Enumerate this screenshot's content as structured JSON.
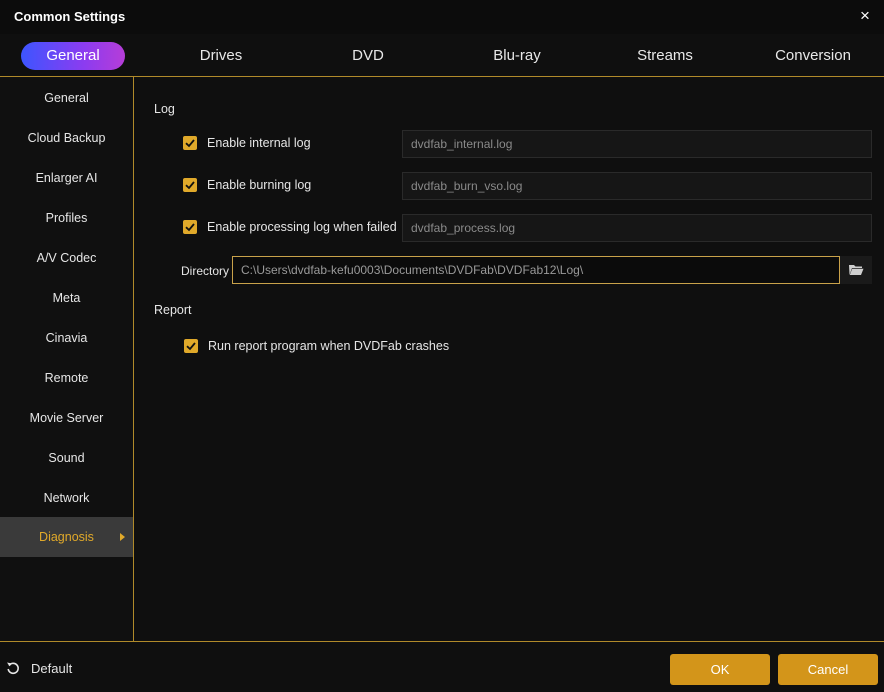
{
  "window": {
    "title": "Common Settings",
    "close_icon": "×"
  },
  "tabs": [
    {
      "label": "General",
      "active": true
    },
    {
      "label": "Drives"
    },
    {
      "label": "DVD"
    },
    {
      "label": "Blu-ray"
    },
    {
      "label": "Streams"
    },
    {
      "label": "Conversion"
    }
  ],
  "sidebar": {
    "items": [
      {
        "label": "General"
      },
      {
        "label": "Cloud Backup"
      },
      {
        "label": "Enlarger AI"
      },
      {
        "label": "Profiles"
      },
      {
        "label": "A/V Codec"
      },
      {
        "label": "Meta"
      },
      {
        "label": "Cinavia"
      },
      {
        "label": "Remote"
      },
      {
        "label": "Movie Server"
      },
      {
        "label": "Sound"
      },
      {
        "label": "Network"
      },
      {
        "label": "Diagnosis",
        "active": true
      }
    ]
  },
  "log": {
    "title": "Log",
    "internal": {
      "label": "Enable internal log",
      "checked": true,
      "value": "dvdfab_internal.log"
    },
    "burning": {
      "label": "Enable burning log",
      "checked": true,
      "value": "dvdfab_burn_vso.log"
    },
    "processing": {
      "label": "Enable processing log when failed",
      "checked": true,
      "value": "dvdfab_process.log"
    },
    "directory": {
      "label": "Directory",
      "value": "C:\\Users\\dvdfab-kefu0003\\Documents\\DVDFab\\DVDFab12\\Log\\"
    }
  },
  "report": {
    "title": "Report",
    "run": {
      "label": "Run report program when DVDFab crashes",
      "checked": true
    }
  },
  "footer": {
    "default_label": "Default",
    "ok_label": "OK",
    "cancel_label": "Cancel"
  },
  "colors": {
    "accent": "#d3951a",
    "divider": "#b08a2a",
    "tab_gradient_start": "#3d55ff",
    "tab_gradient_end": "#b63dd8"
  }
}
